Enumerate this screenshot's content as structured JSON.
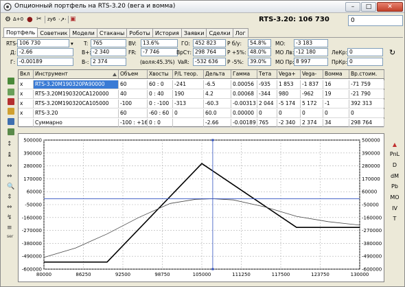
{
  "window": {
    "title": "Опционный портфель на RTS-3.20 (вега и вомма)",
    "buttons": [
      "–",
      "□",
      "✕"
    ]
  },
  "toolbar": {
    "btn_d": "Δ+0",
    "btn_zy6": "zy6"
  },
  "header": {
    "ticker": "RTS-3.20: 106 730",
    "value_box": "0"
  },
  "tabs": [
    "Портфель",
    "Советник",
    "Модели",
    "Стаканы",
    "Роботы",
    "История",
    "Заявки",
    "Сделки",
    "Лог"
  ],
  "params": {
    "instrument_label": "RTS-3.20",
    "instrument_value": "106 730",
    "D_label": "Д:",
    "D_value": "-2.66",
    "G_label": "Г:",
    "G_value": "-0.00189",
    "T_label": "T:",
    "T_value": "765",
    "Bplus_label": "B+:",
    "Bplus_value": "-2 340",
    "Bminus_label": "B-:",
    "Bminus_value": "2 374",
    "BV_label": "BV:",
    "BV_value": "13.6%",
    "FR_label": "FR:",
    "FR_value": "-7 746",
    "vol_label": "(воля:45.3%)",
    "GO_label": "ГО:",
    "GO_value": "452 823",
    "VrSt_label": "ВрСт:",
    "VrSt_value": "298 764",
    "VaR_label": "VaR:",
    "VaR_value": "-532 636",
    "Pbu_label": "P б/у:",
    "Pbu_value": "54.8%",
    "P5p_label": "P +5%:",
    "P5p_value": "48.0%",
    "P5m_label": "P -5%:",
    "P5m_value": "39.0%",
    "MO_label": "МО:",
    "MO_value": "-3 183",
    "MOL_label": "МО Лв:",
    "MOL_value": "-12 180",
    "MOP_label": "МО Пр:",
    "MOP_value": "8 997",
    "LeKr_label": "ЛеКр:",
    "LeKr_value": "0",
    "PrKr_label": "ПрКр:",
    "PrKr_value": "0"
  },
  "table": {
    "columns": [
      "Вкл",
      "Инструмент",
      "Объем",
      "Хвосты",
      "P/L теор.",
      "Дельта",
      "Гамма",
      "Тета",
      "Vega+",
      "Vega-",
      "Вомма",
      "Вр.стоим."
    ],
    "rows": [
      [
        "x",
        "RTS-3.20M190320PA90000",
        "60",
        "60 : 0",
        "-241",
        "-6.5",
        "0.00056",
        "-935",
        "1 853",
        "-1 837",
        "16",
        "-71 759"
      ],
      [
        "x",
        "RTS-3.20M190320CA120000",
        "40",
        "0 : 40",
        "190",
        "4.2",
        "0.00068",
        "-344",
        "980",
        "-962",
        "19",
        "-21 790"
      ],
      [
        "x",
        "RTS-3.20M190320CA105000",
        "-100",
        "0 : -100",
        "-313",
        "-60.3",
        "-0.00313",
        "2 044",
        "-5 174",
        "5 172",
        "-1",
        "392 313"
      ],
      [
        "x",
        "RTS-3.20",
        "60",
        "-60 : 60",
        "0",
        "60.0",
        "0.00000",
        "0",
        "0",
        "0",
        "0",
        "0"
      ],
      [
        "",
        "Суммарно",
        "-100 : +160",
        "0 : 0",
        "",
        "-2.66",
        "-0.00189",
        "765",
        "-2 340",
        "2 374",
        "34",
        "298 764"
      ]
    ]
  },
  "right_buttons": [
    "PnL",
    "D",
    "dM",
    "Pb",
    "MO",
    "IV",
    "T"
  ],
  "left_tools": [
    "↕",
    "↨",
    "↔",
    "⇔",
    "🔍",
    "⇕",
    "⇔",
    "↯",
    "≡",
    "ser"
  ],
  "chart_data": {
    "type": "line",
    "x_ticks": [
      "80000",
      "86250",
      "92500",
      "98750",
      "105000",
      "111250",
      "117500",
      "123750",
      "130000"
    ],
    "y_ticks": [
      "500000",
      "390000",
      "280000",
      "170000",
      "60000",
      "-50000",
      "-160000",
      "-270000",
      "-380000",
      "-490000",
      "-600000"
    ],
    "xlim": [
      80000,
      130000
    ],
    "ylim": [
      -600000,
      500000
    ],
    "cursor_x": 106730,
    "cursor_y": 0,
    "series": [
      {
        "color": "#000000",
        "width": 1.6,
        "points": [
          [
            80000,
            -540000
          ],
          [
            90000,
            -540000
          ],
          [
            105000,
            300000
          ],
          [
            120000,
            -244000
          ],
          [
            130000,
            -244000
          ]
        ]
      },
      {
        "color": "#444444",
        "width": 0.8,
        "points": [
          [
            80000,
            -500000
          ],
          [
            85000,
            -420000
          ],
          [
            90000,
            -300000
          ],
          [
            95000,
            -160000
          ],
          [
            100000,
            -40000
          ],
          [
            104000,
            -5000
          ],
          [
            106730,
            0
          ],
          [
            110000,
            -10000
          ],
          [
            115000,
            -70000
          ],
          [
            120000,
            -150000
          ],
          [
            125000,
            -195000
          ],
          [
            130000,
            -225000
          ]
        ]
      }
    ]
  }
}
